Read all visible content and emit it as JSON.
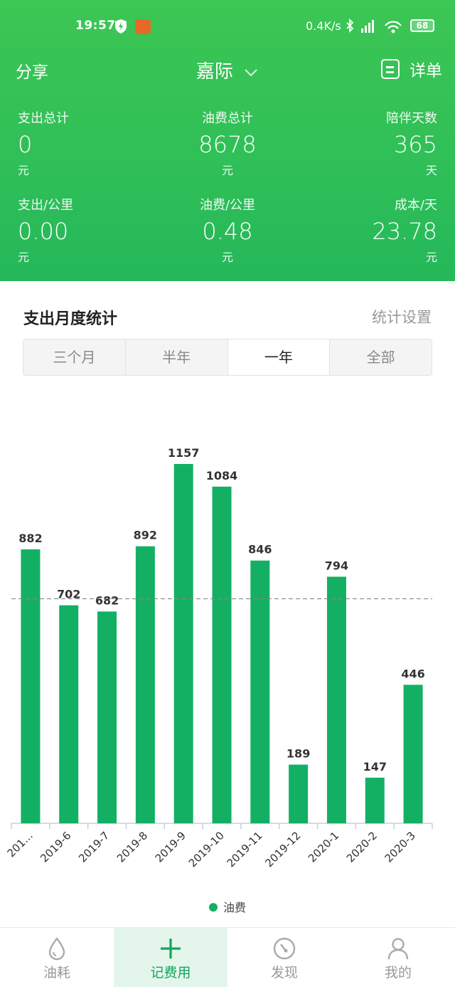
{
  "status_bar": {
    "time": "19:57",
    "net_speed": "0.4K/s",
    "battery": "68"
  },
  "top_bar": {
    "share_label": "分享",
    "car_name": "嘉际",
    "detail_label": "详单"
  },
  "stats": [
    {
      "label": "支出总计",
      "value": "0",
      "unit": "元"
    },
    {
      "label": "油费总计",
      "value": "8678",
      "unit": "元"
    },
    {
      "label": "陪伴天数",
      "value": "365",
      "unit": "天"
    },
    {
      "label": "支出/公里",
      "value": "0.00",
      "unit": "元"
    },
    {
      "label": "油费/公里",
      "value": "0.48",
      "unit": "元"
    },
    {
      "label": "成本/天",
      "value": "23.78",
      "unit": "元"
    }
  ],
  "section": {
    "title": "支出月度统计",
    "settings_label": "统计设置"
  },
  "range_tabs": [
    "三个月",
    "半年",
    "一年",
    "全部"
  ],
  "range_selected": "一年",
  "chart_data": {
    "type": "bar",
    "categories": [
      "201...",
      "2019-6",
      "2019-7",
      "2019-8",
      "2019-9",
      "2019-10",
      "2019-11",
      "2019-12",
      "2020-1",
      "2020-2",
      "2020-3"
    ],
    "series": [
      {
        "name": "油费",
        "values": [
          882,
          702,
          682,
          892,
          1157,
          1084,
          846,
          189,
          794,
          147,
          446
        ],
        "color": "#13b064"
      }
    ],
    "average_line": 723,
    "ylim": [
      0,
      1200
    ],
    "grid": false,
    "legend": "bottom-center"
  },
  "legend_label": "油费",
  "tabs": [
    {
      "label": "油耗",
      "icon": "drop-icon"
    },
    {
      "label": "记费用",
      "icon": "plus-icon"
    },
    {
      "label": "发现",
      "icon": "gauge-icon"
    },
    {
      "label": "我的",
      "icon": "person-icon"
    }
  ],
  "active_tab": "记费用",
  "colors": {
    "brand_green": "#2fbf58",
    "bar_green": "#13b064",
    "active_tab_bg": "#e4f6ec"
  }
}
